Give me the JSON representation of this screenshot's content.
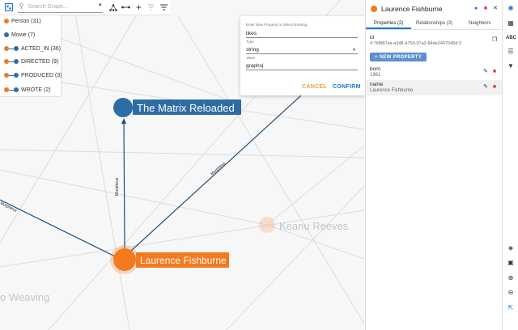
{
  "toolbar": {
    "search_placeholder": "Search Graph...",
    "icons": [
      "graph-view-icon",
      "search-icon",
      "chevron-down-icon",
      "hierarchy-icon",
      "relationship-icon",
      "add-icon",
      "filter-off-icon",
      "list-filter-icon"
    ]
  },
  "legend": {
    "items": [
      {
        "label": "Person (31)",
        "kind": "node",
        "color": "#f4791f"
      },
      {
        "label": "Movie (7)",
        "kind": "node",
        "color": "#2e6da4"
      },
      {
        "label": "ACTED_IN (36)",
        "kind": "rel",
        "from": "#f4791f",
        "to": "#2e6da4"
      },
      {
        "label": "DIRECTED (9)",
        "kind": "rel",
        "from": "#f4791f",
        "to": "#2e6da4"
      },
      {
        "label": "PRODUCED (3)",
        "kind": "rel",
        "from": "#f4791f",
        "to": "#2e6da4"
      },
      {
        "label": "WROTE (2)",
        "kind": "rel",
        "from": "#f4791f",
        "to": "#2e6da4"
      }
    ]
  },
  "dialog": {
    "key_caption": "Enter New Property or Select Existing",
    "key_value": "likes",
    "type_caption": "Type",
    "type_value": "string",
    "value_caption": "Value",
    "value_value": "graphs|",
    "cancel_label": "CANCEL",
    "confirm_label": "CONFIRM"
  },
  "panel": {
    "title": "Laurence Fishburne",
    "node_color": "#f4791f",
    "tabs": [
      {
        "label": "Properties (2)",
        "active": true
      },
      {
        "label": "Relationships (3)",
        "active": false
      },
      {
        "label": "Neighbors",
        "active": false
      }
    ],
    "id_key": "id",
    "id_value": "4:7bf987aa-a3d8-4759-97a2-84de2407045d:3",
    "new_property_label": "+ NEW PROPERTY",
    "properties": [
      {
        "key": "born",
        "value": "1961"
      },
      {
        "key": "name",
        "value": "Laurence Fishburne"
      }
    ]
  },
  "graph": {
    "nodes": [
      {
        "label": "The Matrix Reloaded",
        "color": "#2e6da4"
      },
      {
        "label": "Laurence Fishburne",
        "color": "#f4791f"
      },
      {
        "label": "Keanu Reeves",
        "color": "#f4791f"
      },
      {
        "label": "o Weaving",
        "color": "#f4791f"
      }
    ],
    "edges": [
      {
        "label": "Morpheus"
      },
      {
        "label": "Morpheus"
      },
      {
        "label": "Morpheus"
      }
    ]
  },
  "colors": {
    "accent": "#1976d2",
    "person": "#f4791f",
    "movie": "#2e6da4",
    "cancel": "#f0a030",
    "confirm": "#1976d2",
    "delete": "#e53935"
  }
}
